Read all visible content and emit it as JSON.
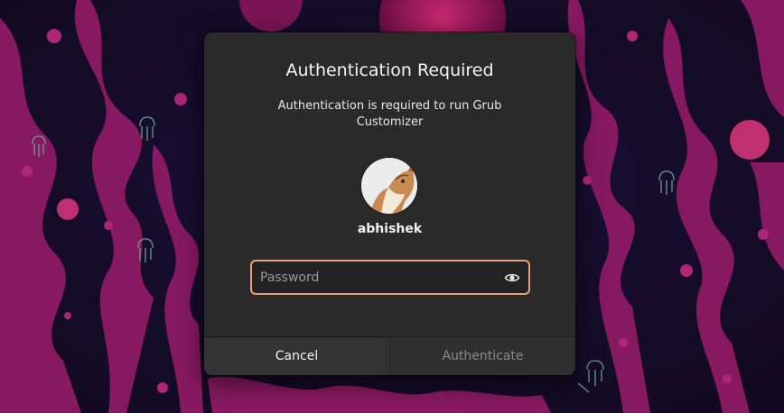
{
  "dialog": {
    "title": "Authentication Required",
    "message": "Authentication is required to run Grub Customizer",
    "username": "abhishek",
    "password": {
      "value": "",
      "placeholder": "Password",
      "reveal_icon": "eye-icon"
    },
    "buttons": {
      "cancel": "Cancel",
      "authenticate": "Authenticate"
    }
  },
  "colors": {
    "wallpaper_base": "#1b0f2e",
    "wallpaper_accent": "#9c1f6e",
    "dialog_bg": "#2a2a2a",
    "focus_ring": "#e9a07c",
    "disabled_text": "#8a8a8a"
  }
}
